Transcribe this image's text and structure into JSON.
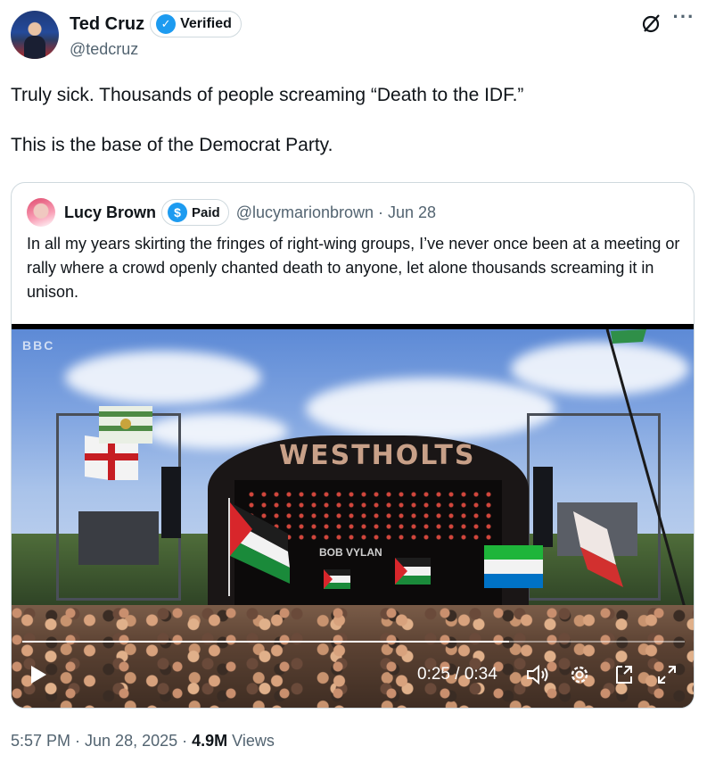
{
  "author": {
    "display_name": "Ted Cruz",
    "verified_label": "Verified",
    "handle": "@tedcruz"
  },
  "tweet": {
    "text": "Truly sick. Thousands of people screaming “Death to the IDF.”\n\nThis is the base of the Democrat Party."
  },
  "quote": {
    "display_name": "Lucy Brown",
    "paid_label": "Paid",
    "meta": "@lucymarionbrown · Jun 28",
    "text": "In all my years skirting the fringes of right-wing groups, I’ve never once been at a meeting or rally where a crowd openly chanted death to anyone, let alone thousands screaming it in unison.",
    "video": {
      "stage_sign": "WESTHOLTS",
      "band_name": "BOB VYLAN",
      "time": "0:25 / 0:34",
      "progress": 0.735
    }
  },
  "footer": {
    "time": "5:57 PM · Jun 28, 2025 · ",
    "views_count": "4.9M",
    "views_label": " Views"
  },
  "icons": {
    "verified": "check-badge-icon",
    "paid": "dollar-badge-icon",
    "grok": "grok-icon",
    "more": "more-icon",
    "play": "play-icon",
    "volume": "volume-icon",
    "settings": "gear-icon",
    "pip": "picture-in-picture-icon",
    "fullscreen": "fullscreen-icon"
  },
  "colors": {
    "accent": "#1d9bf0",
    "text": "#0f1419",
    "secondary": "#536471",
    "border": "#cfd9de"
  }
}
